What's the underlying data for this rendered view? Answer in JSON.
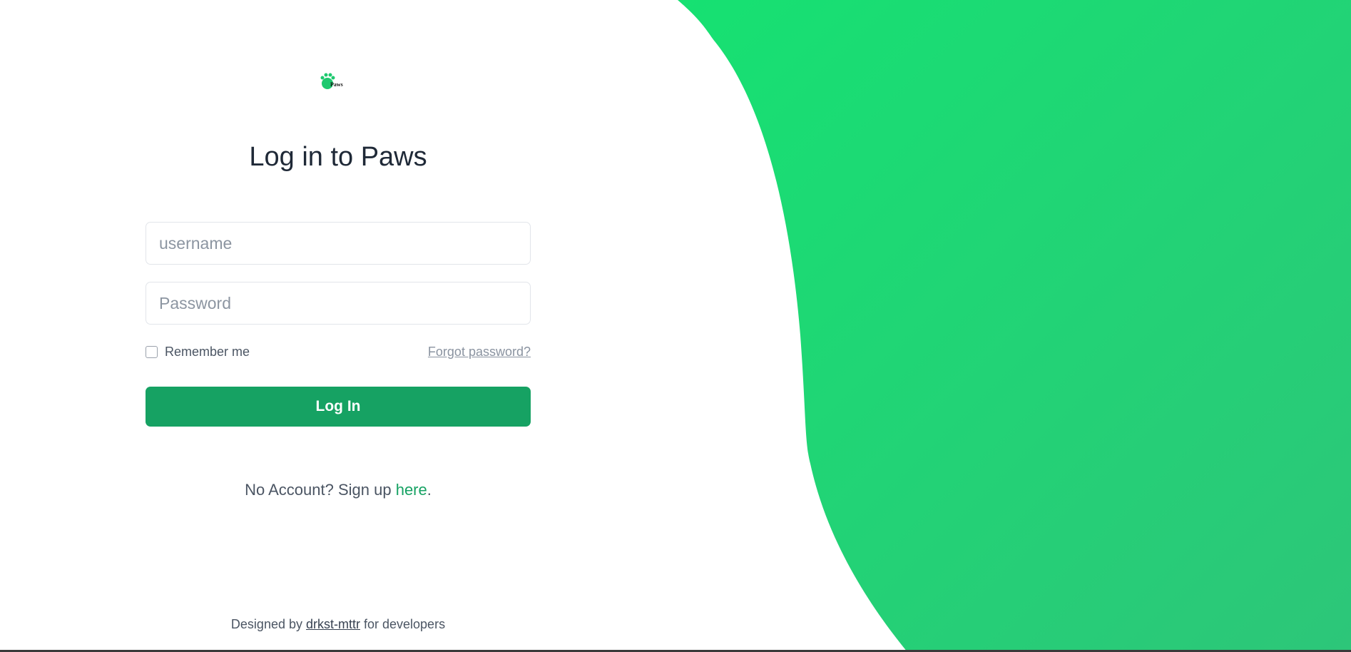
{
  "brand": {
    "logo_text": "Paws",
    "accent_color": "#16a263",
    "panel_gradient": [
      "#1ae074",
      "#2cc77a"
    ]
  },
  "login": {
    "title": "Log in to Paws",
    "username_placeholder": "username",
    "password_placeholder": "Password",
    "remember_label": "Remember me",
    "remember_checked": false,
    "forgot_label": "Forgot password?",
    "submit_label": "Log In"
  },
  "signup": {
    "prefix": "No Account? Sign up ",
    "link_label": "here",
    "suffix": "."
  },
  "footer": {
    "prefix": "Designed by ",
    "author": "drkst-mttr",
    "suffix": " for developers"
  }
}
